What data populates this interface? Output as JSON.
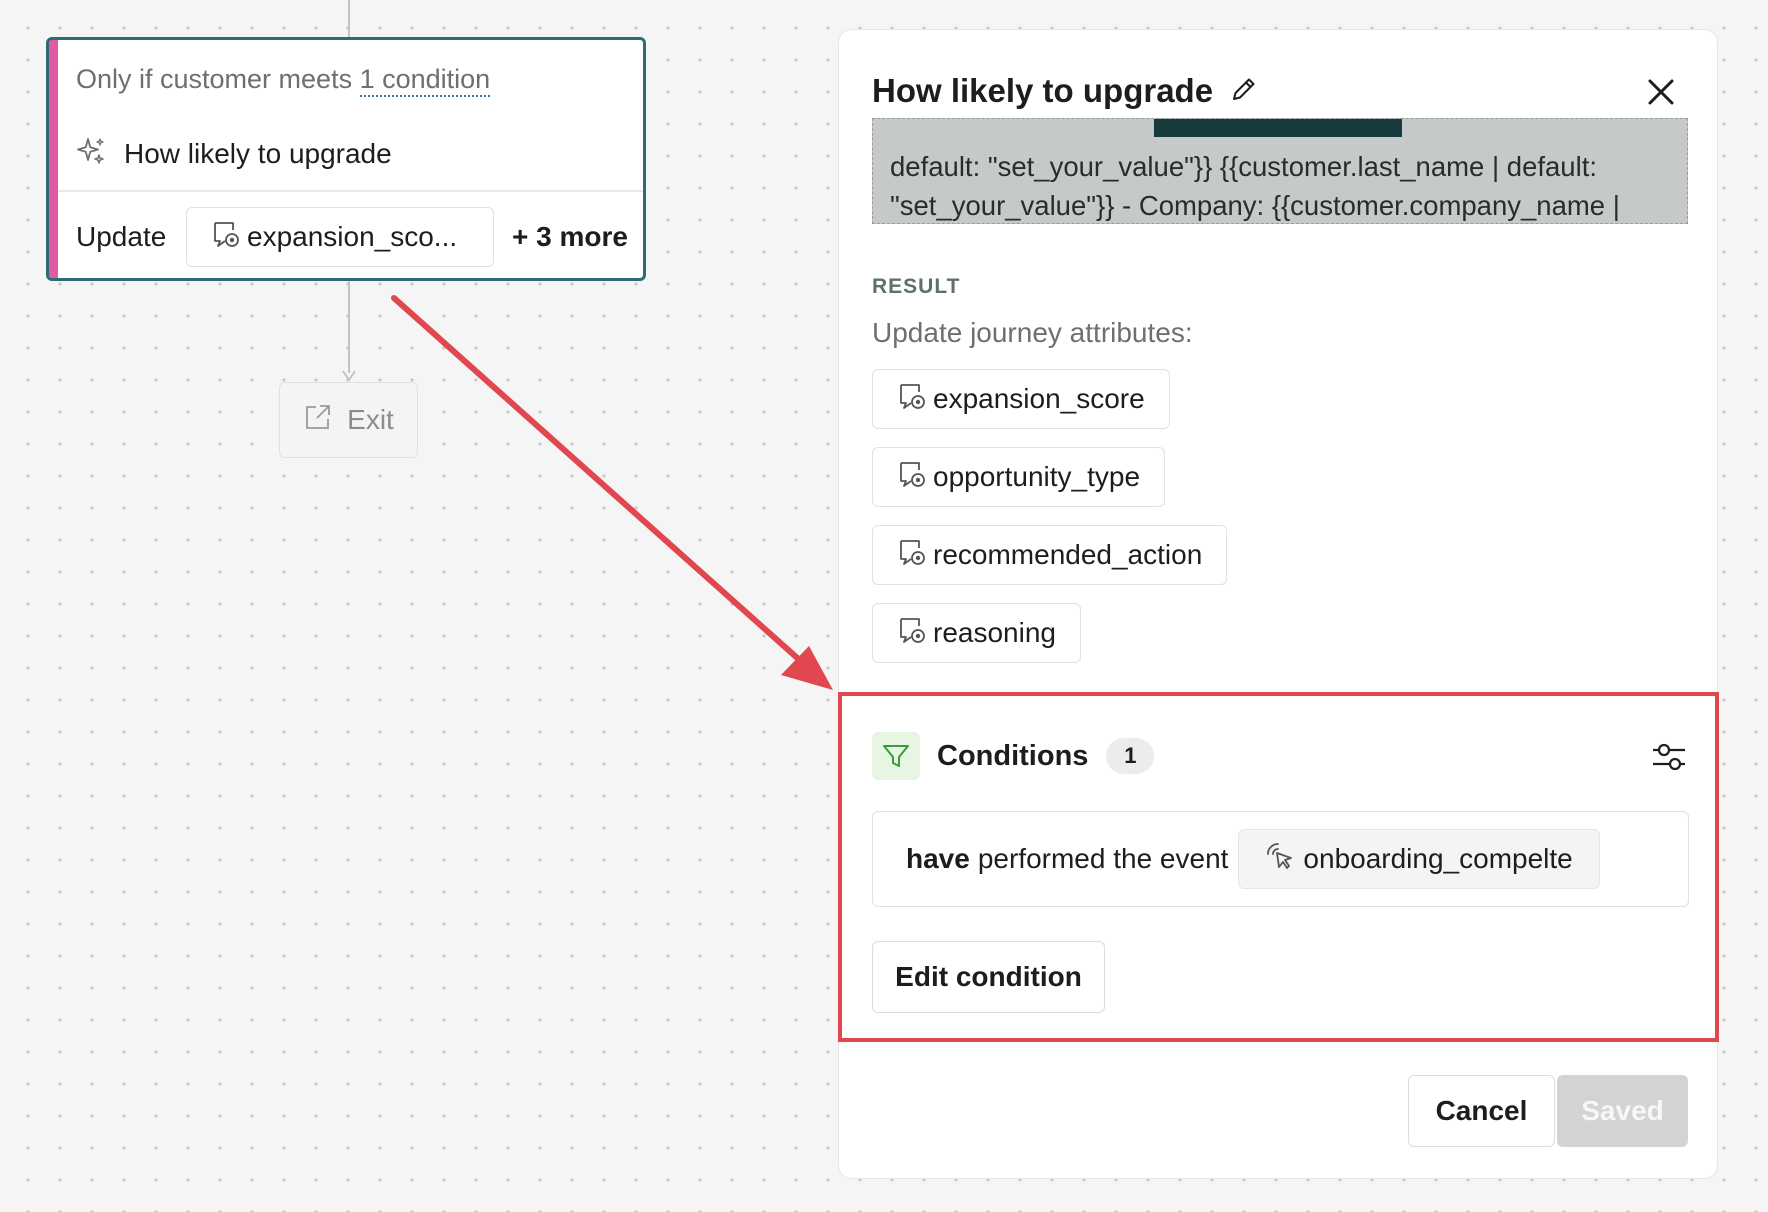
{
  "canvas": {
    "node": {
      "condition_prefix": "Only if customer meets ",
      "condition_link": "1 condition",
      "title": "How likely to upgrade",
      "update_label": "Update",
      "chip_label": "expansion_sco...",
      "more_label": "+ 3 more",
      "accent_color": "#df5aa3",
      "border_color": "#2f6b74"
    },
    "exit_node": {
      "label": "Exit"
    }
  },
  "panel": {
    "title": "How likely to upgrade",
    "prompt_text": "default: \"set_your_value\"}} {{customer.last_name | default:\n\"set_your_value\"}} - Company: {{customer.company_name |\ndefault: \"set_your_value\"}} - Current plan:",
    "result": {
      "label": "RESULT",
      "subtitle": "Update journey attributes:",
      "attributes": [
        "expansion_score",
        "opportunity_type",
        "recommended_action",
        "reasoning"
      ]
    },
    "conditions": {
      "title": "Conditions",
      "count": "1",
      "condition": {
        "qualifier": "have",
        "text": "performed the event",
        "event_name": "onboarding_compelte"
      },
      "edit_label": "Edit condition",
      "highlight_color": "#e0474f"
    },
    "footer": {
      "cancel_label": "Cancel",
      "saved_label": "Saved"
    }
  },
  "icons": {
    "sparkle": "sparkle-icon",
    "attribute": "journey-attribute-icon",
    "exit": "external-link-icon",
    "edit": "pencil-icon",
    "close": "close-icon",
    "filter": "filter-icon",
    "settings": "sliders-icon",
    "event": "cursor-click-icon"
  },
  "annotation": {
    "arrow_color": "#e0474f"
  }
}
